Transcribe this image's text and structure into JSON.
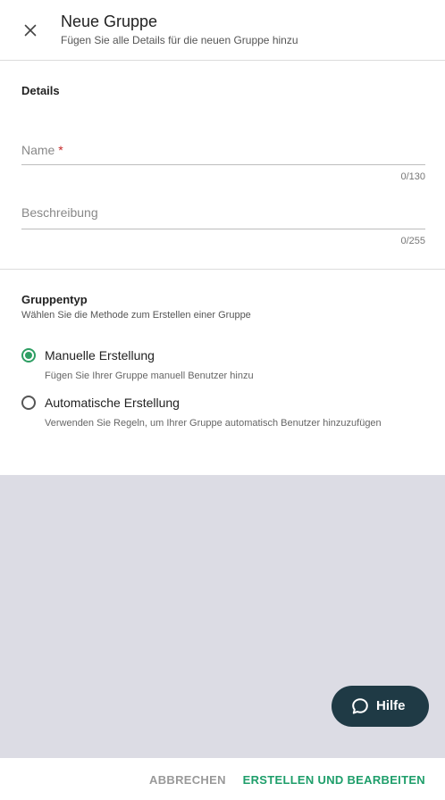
{
  "header": {
    "title": "Neue Gruppe",
    "subtitle": "Fügen Sie alle Details für die neuen Gruppe hinzu"
  },
  "details": {
    "title": "Details",
    "name_label": "Name",
    "name_required_mark": "*",
    "name_counter": "0/130",
    "description_label": "Beschreibung",
    "description_counter": "0/255"
  },
  "group_type": {
    "title": "Gruppentyp",
    "subtitle": "Wählen Sie die Methode zum Erstellen einer Gruppe",
    "options": [
      {
        "label": "Manuelle Erstellung",
        "description": "Fügen Sie Ihrer Gruppe manuell Benutzer hinzu",
        "selected": true
      },
      {
        "label": "Automatische Erstellung",
        "description": "Verwenden Sie Regeln, um Ihrer Gruppe automatisch Benutzer hinzuzufügen",
        "selected": false
      }
    ]
  },
  "help": {
    "label": "Hilfe",
    "icon": "chat-bubble-icon"
  },
  "footer": {
    "cancel_label": "ABBRECHEN",
    "create_label": "ERSTELLEN UND BEARBEITEN"
  },
  "colors": {
    "accent": "#2e9e63",
    "help_button": "#1f3a45",
    "required": "#c62828",
    "backdrop": "#dcdce4"
  }
}
